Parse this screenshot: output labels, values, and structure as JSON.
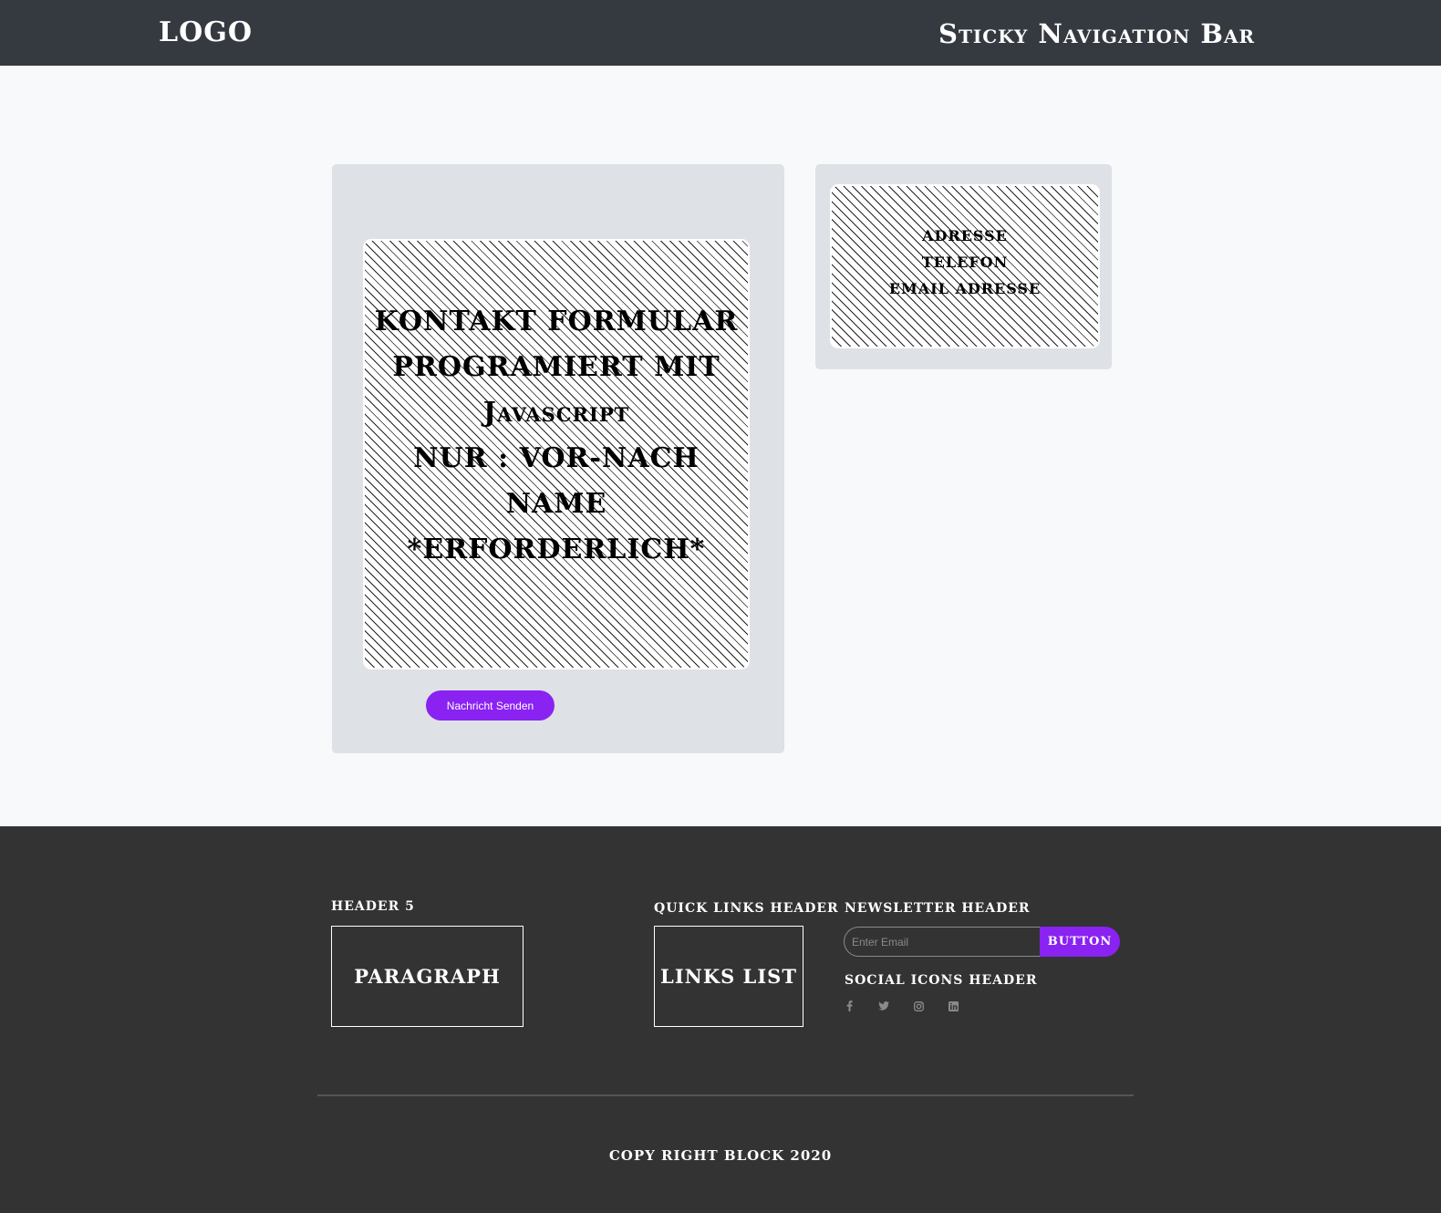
{
  "nav": {
    "logo": "LOGO",
    "title": "Sticky Navigation Bar"
  },
  "contact_form": {
    "lines": [
      "KONTAKT FORMULAR",
      "PROGRAMIERT MIT",
      "Javascript",
      "NUR : VOR-NACH NAME",
      "*ERFORDERLICH*"
    ],
    "submit_label": "Nachricht Senden"
  },
  "contact_info": {
    "lines": [
      "ADRESSE",
      "TELEFON",
      "EMAIL ADRESSE"
    ]
  },
  "footer": {
    "header5": "HEADER 5",
    "paragraph": "PARAGRAPH",
    "quick_links_header": "QUICK LINKS HEADER",
    "links_list": "LINKS LIST",
    "newsletter_header": "NEWSLETTER HEADER",
    "email_placeholder": "Enter Email",
    "newsletter_button": "BUTTON",
    "social_header": "SOCIAL ICONS HEADER",
    "social_icons": [
      "facebook-icon",
      "twitter-icon",
      "instagram-icon",
      "linkedin-icon"
    ],
    "copyright": "COPY RIGHT BLOCK 2020"
  },
  "colors": {
    "nav_bg": "#343a40",
    "footer_bg": "#333333",
    "accent": "#8a22f2",
    "card_bg": "#dee1e5",
    "page_bg": "#f8f9fa"
  }
}
